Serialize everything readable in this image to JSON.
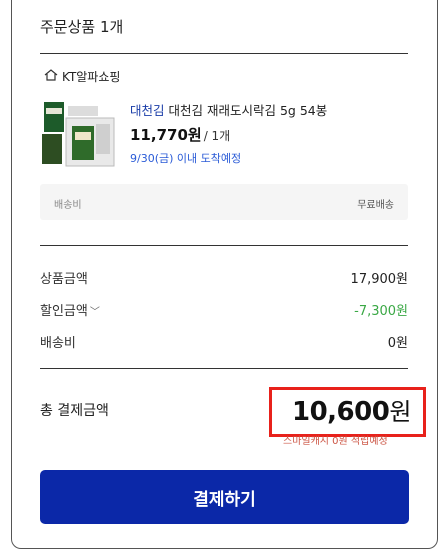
{
  "order": {
    "title": "주문상품 1개"
  },
  "seller": {
    "name": "KT알파쇼핑",
    "icon": "home-icon"
  },
  "product": {
    "brand": "대천김",
    "name": "대천김 재래도시락김 5g 54봉",
    "price": "11,770원",
    "qty": "/ 1개",
    "eta": "9/30(금) 이내 도착예정"
  },
  "shipping_box": {
    "label": "배송비",
    "value": "무료배송"
  },
  "summary": {
    "items": [
      {
        "label": "상품금액",
        "value": "17,900원"
      },
      {
        "label": "할인금액",
        "value": "-7,300원"
      },
      {
        "label": "배송비",
        "value": "0원"
      }
    ]
  },
  "total": {
    "label": "총 결제금액",
    "amount": "10,600",
    "unit": "원",
    "points": "스마일캐시 0원 적립예정"
  },
  "pay_button": {
    "label": "결제하기"
  },
  "colors": {
    "accent": "#0b28a8",
    "discount": "#3aa845",
    "highlight": "#e8211b",
    "link": "#2a5bd7"
  }
}
